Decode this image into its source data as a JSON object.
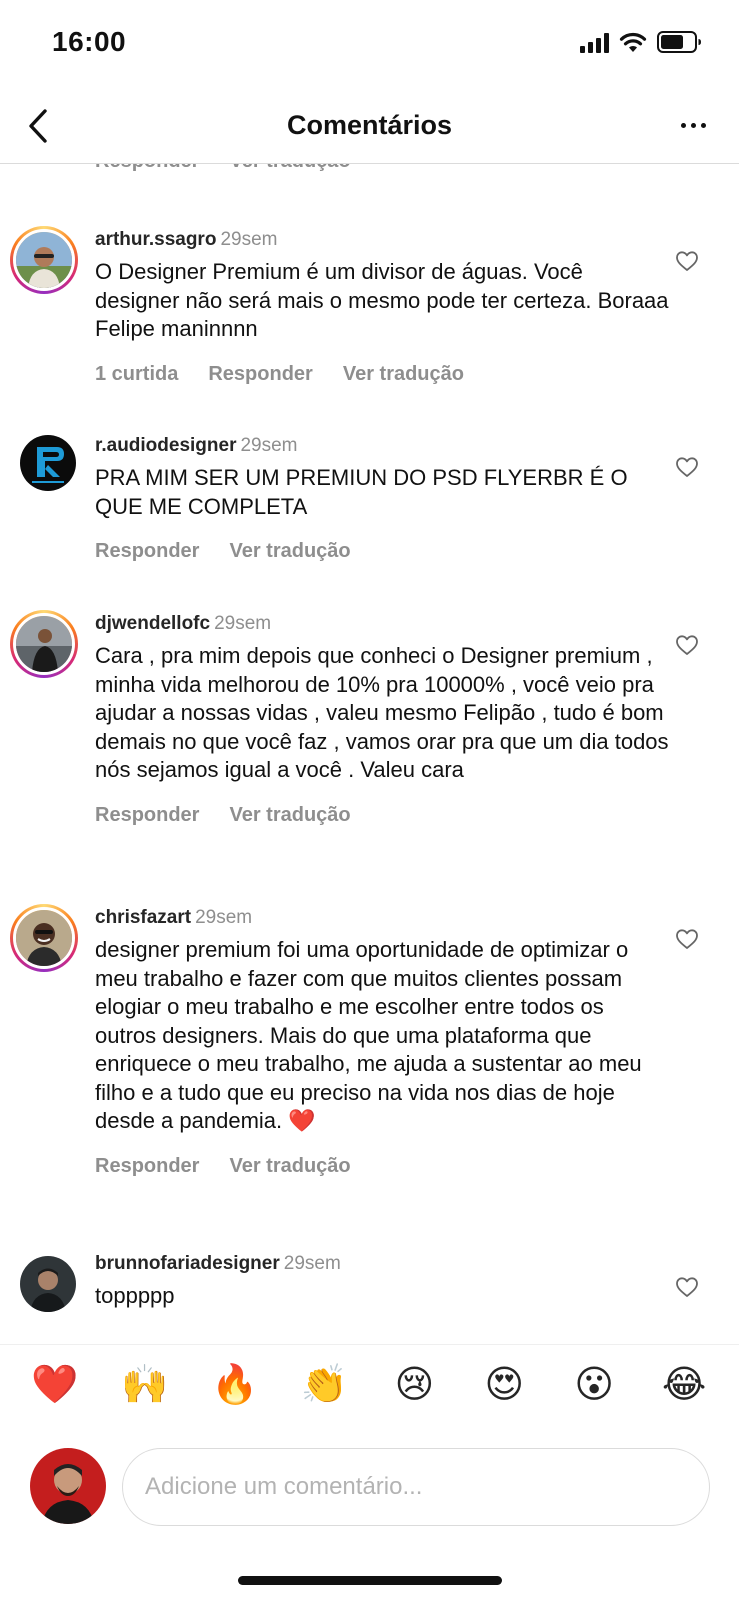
{
  "status_bar": {
    "time": "16:00"
  },
  "nav": {
    "title": "Comentários"
  },
  "cut_comment": {
    "reply_label": "Responder",
    "translate_label": "Ver tradução"
  },
  "comments": [
    {
      "username": "arthur.ssagro",
      "time": "29sem",
      "text": "O Designer Premium é um divisor de águas. Você designer não será mais o mesmo pode ter certeza. Boraaa Felipe maninnnn",
      "likes_label": "1 curtida",
      "reply_label": "Responder",
      "translate_label": "Ver tradução"
    },
    {
      "username": "r.audiodesigner",
      "time": "29sem",
      "text": "PRA MIM SER UM PREMIUN DO PSD FLYERBR É O QUE ME COMPLETA",
      "reply_label": "Responder",
      "translate_label": "Ver tradução"
    },
    {
      "username": "djwendellofc",
      "time": "29sem",
      "text": "Cara , pra mim depois que conheci o Designer premium , minha vida melhorou de 10% pra 10000% , você veio pra ajudar a nossas vidas , valeu mesmo Felipão , tudo é bom demais no que você faz , vamos orar pra que um dia todos nós sejamos igual a você . Valeu cara",
      "reply_label": "Responder",
      "translate_label": "Ver tradução"
    },
    {
      "username": "chrisfazart",
      "time": "29sem",
      "text": "designer premium foi uma oportunidade de optimizar o meu trabalho e fazer com que muitos clientes possam elogiar o meu trabalho e me escolher entre todos os outros designers. Mais do que uma plataforma que enriquece o meu trabalho, me ajuda a sustentar ao meu filho e a tudo que eu preciso na vida nos dias de hoje desde a pandemia. ❤️",
      "reply_label": "Responder",
      "translate_label": "Ver tradução"
    },
    {
      "username": "brunnofariadesigner",
      "time": "29sem",
      "text": "toppppp"
    }
  ],
  "reactions": [
    "❤️",
    "🙌",
    "🔥",
    "👏",
    "😢",
    "😍",
    "😮",
    "😂"
  ],
  "composer": {
    "placeholder": "Adicione um comentário..."
  },
  "colors": {
    "text": "#262626",
    "muted": "#8e8e8e",
    "divider": "#dbdbdb",
    "heart": "#ed4956"
  }
}
